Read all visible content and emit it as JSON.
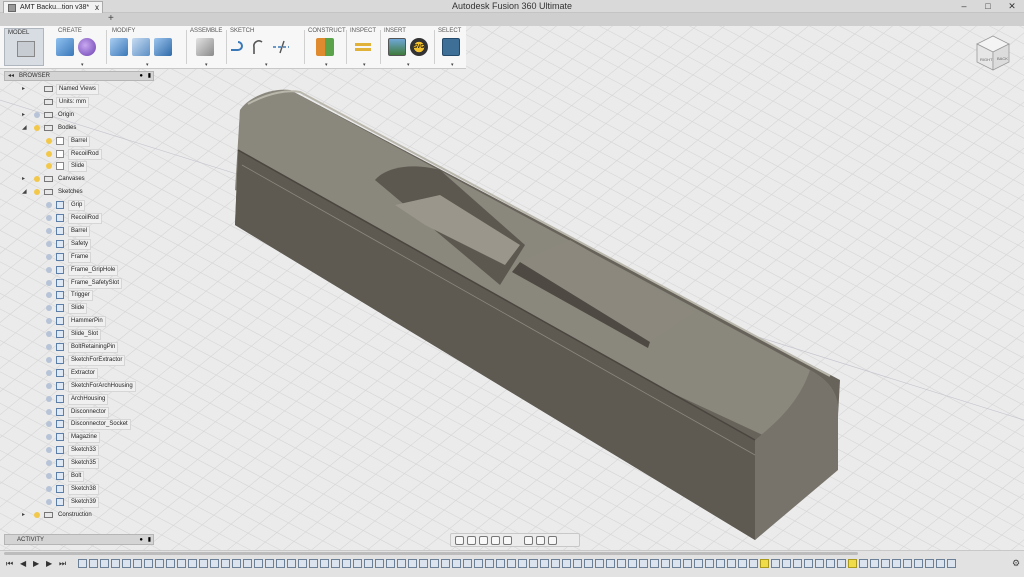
{
  "app": {
    "title": "Autodesk Fusion 360 Ultimate"
  },
  "window_controls": {
    "minimize": "–",
    "maximize": "□",
    "close": "✕"
  },
  "tab": {
    "name": "AMT Backu...tion v38*",
    "close": "x",
    "new_tab": "+"
  },
  "ribbon": {
    "workspace": "MODEL",
    "groups": [
      {
        "label": "CREATE",
        "icons": [
          "box-icon",
          "sphere-icon"
        ]
      },
      {
        "label": "MODIFY",
        "icons": [
          "press-pull-icon",
          "fillet-icon",
          "shell-icon"
        ]
      },
      {
        "label": "ASSEMBLE",
        "icons": [
          "joint-icon"
        ]
      },
      {
        "label": "SKETCH",
        "icons": [
          "line-icon",
          "arc-icon",
          "trim-icon"
        ]
      },
      {
        "label": "CONSTRUCT",
        "icons": [
          "plane-icon"
        ]
      },
      {
        "label": "INSPECT",
        "icons": [
          "measure-icon"
        ]
      },
      {
        "label": "INSERT",
        "icons": [
          "insert-image-icon",
          "insert-svg-icon"
        ]
      },
      {
        "label": "SELECT",
        "icons": [
          "select-icon"
        ]
      }
    ],
    "svg_badge": "SVG"
  },
  "viewcube": {
    "left": "RIGHT",
    "front": "BACK"
  },
  "browser": {
    "title": "BROWSER",
    "items": [
      {
        "label": "Named Views",
        "level": 1,
        "exp": "▸",
        "kind": "folder",
        "bulb": false
      },
      {
        "label": "Units: mm",
        "level": 1,
        "exp": "",
        "kind": "doc",
        "bulb": false
      },
      {
        "label": "Origin",
        "level": 1,
        "exp": "▸",
        "kind": "folder",
        "bulb": true,
        "bulbColor": "#b7c4d8"
      },
      {
        "label": "Bodies",
        "level": 1,
        "exp": "◢",
        "kind": "folder",
        "bulb": true,
        "bulbColor": "#f2c84b"
      },
      {
        "label": "Barrel",
        "level": 2,
        "exp": "",
        "kind": "body",
        "bulb": true,
        "bulbColor": "#f2c84b"
      },
      {
        "label": "RecoilRod",
        "level": 2,
        "exp": "",
        "kind": "body",
        "bulb": true,
        "bulbColor": "#f2c84b"
      },
      {
        "label": "Slide",
        "level": 2,
        "exp": "",
        "kind": "body",
        "bulb": true,
        "bulbColor": "#f2c84b"
      },
      {
        "label": "Canvases",
        "level": 1,
        "exp": "▸",
        "kind": "folder",
        "bulb": true,
        "bulbColor": "#f2c84b"
      },
      {
        "label": "Sketches",
        "level": 1,
        "exp": "◢",
        "kind": "folder",
        "bulb": true,
        "bulbColor": "#f2c84b"
      },
      {
        "label": "Grip",
        "level": 2,
        "exp": "",
        "kind": "sketch",
        "bulb": true,
        "bulbColor": "#b7c4d8"
      },
      {
        "label": "RecoilRod",
        "level": 2,
        "exp": "",
        "kind": "sketch",
        "bulb": true,
        "bulbColor": "#b7c4d8"
      },
      {
        "label": "Barrel",
        "level": 2,
        "exp": "",
        "kind": "sketch",
        "bulb": true,
        "bulbColor": "#b7c4d8"
      },
      {
        "label": "Safety",
        "level": 2,
        "exp": "",
        "kind": "sketch",
        "bulb": true,
        "bulbColor": "#b7c4d8"
      },
      {
        "label": "Frame",
        "level": 2,
        "exp": "",
        "kind": "sketch",
        "bulb": true,
        "bulbColor": "#b7c4d8"
      },
      {
        "label": "Frame_GripHole",
        "level": 2,
        "exp": "",
        "kind": "sketch",
        "bulb": true,
        "bulbColor": "#b7c4d8"
      },
      {
        "label": "Frame_SafetySlot",
        "level": 2,
        "exp": "",
        "kind": "sketch",
        "bulb": true,
        "bulbColor": "#b7c4d8"
      },
      {
        "label": "Trigger",
        "level": 2,
        "exp": "",
        "kind": "sketch",
        "bulb": true,
        "bulbColor": "#b7c4d8"
      },
      {
        "label": "Slide",
        "level": 2,
        "exp": "",
        "kind": "sketch",
        "bulb": true,
        "bulbColor": "#b7c4d8"
      },
      {
        "label": "HammerPin",
        "level": 2,
        "exp": "",
        "kind": "sketch",
        "bulb": true,
        "bulbColor": "#b7c4d8"
      },
      {
        "label": "Slide_Slot",
        "level": 2,
        "exp": "",
        "kind": "sketch",
        "bulb": true,
        "bulbColor": "#b7c4d8"
      },
      {
        "label": "BoltRetainingPin",
        "level": 2,
        "exp": "",
        "kind": "sketch",
        "bulb": true,
        "bulbColor": "#b7c4d8"
      },
      {
        "label": "SketchForExtractor",
        "level": 2,
        "exp": "",
        "kind": "sketch",
        "bulb": true,
        "bulbColor": "#b7c4d8"
      },
      {
        "label": "Extractor",
        "level": 2,
        "exp": "",
        "kind": "sketch",
        "bulb": true,
        "bulbColor": "#b7c4d8"
      },
      {
        "label": "SketchForArchHousing",
        "level": 2,
        "exp": "",
        "kind": "sketch",
        "bulb": true,
        "bulbColor": "#b7c4d8"
      },
      {
        "label": "ArchHousing",
        "level": 2,
        "exp": "",
        "kind": "sketch",
        "bulb": true,
        "bulbColor": "#b7c4d8"
      },
      {
        "label": "Disconnector",
        "level": 2,
        "exp": "",
        "kind": "sketch",
        "bulb": true,
        "bulbColor": "#b7c4d8"
      },
      {
        "label": "Disconnector_Socket",
        "level": 2,
        "exp": "",
        "kind": "sketch",
        "bulb": true,
        "bulbColor": "#b7c4d8"
      },
      {
        "label": "Magazine",
        "level": 2,
        "exp": "",
        "kind": "sketch",
        "bulb": true,
        "bulbColor": "#b7c4d8"
      },
      {
        "label": "Sketch33",
        "level": 2,
        "exp": "",
        "kind": "sketch",
        "bulb": true,
        "bulbColor": "#b7c4d8"
      },
      {
        "label": "Sketch35",
        "level": 2,
        "exp": "",
        "kind": "sketch",
        "bulb": true,
        "bulbColor": "#b7c4d8"
      },
      {
        "label": "Bolt",
        "level": 2,
        "exp": "",
        "kind": "sketch",
        "bulb": true,
        "bulbColor": "#b7c4d8"
      },
      {
        "label": "Sketch38",
        "level": 2,
        "exp": "",
        "kind": "sketch",
        "bulb": true,
        "bulbColor": "#b7c4d8"
      },
      {
        "label": "Sketch39",
        "level": 2,
        "exp": "",
        "kind": "sketch",
        "bulb": true,
        "bulbColor": "#b7c4d8"
      },
      {
        "label": "Construction",
        "level": 1,
        "exp": "▸",
        "kind": "folder",
        "bulb": true,
        "bulbColor": "#f2c84b"
      }
    ]
  },
  "activity": {
    "title": "ACTIVITY"
  },
  "timeline": {
    "controls": [
      "⏮",
      "◀",
      "▶",
      "▶",
      "⏭"
    ],
    "gear": "⚙"
  },
  "colors": {
    "ribbon_bg": "#f7f7f7",
    "viewport_bg": "#ebebeb",
    "grid": "#d2d2d2",
    "model": "#6e6a5e",
    "accent_blue": "#3b78b8"
  }
}
